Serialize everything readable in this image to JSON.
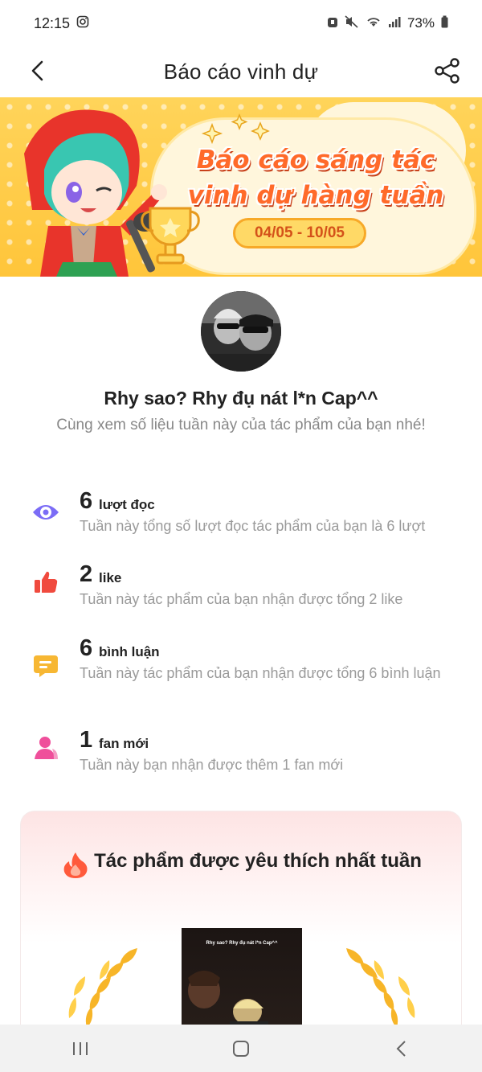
{
  "status_bar": {
    "time": "12:15",
    "battery": "73%"
  },
  "header": {
    "title": "Báo cáo vinh dự"
  },
  "banner": {
    "headline_line1": "Báo cáo sáng tác",
    "headline_line2": "vinh dự hàng tuần",
    "date_range": "04/05 - 10/05"
  },
  "profile": {
    "name": "Rhy sao? Rhy đụ nát l*n Cap^^",
    "subtitle": "Cùng xem số liệu tuần này của tác phẩm của bạn nhé!"
  },
  "stats": [
    {
      "icon": "eye-icon",
      "number": "6",
      "unit": "lượt đọc",
      "desc": "Tuần này tổng số lượt đọc tác phẩm của bạn là 6 lượt",
      "color": "#7b6cf6"
    },
    {
      "icon": "thumbs-up-icon",
      "number": "2",
      "unit": "like",
      "desc": "Tuần này tác phẩm của bạn nhận được tổng 2 like",
      "color": "#f04a3e"
    },
    {
      "icon": "comment-icon",
      "number": "6",
      "unit": "bình luận",
      "desc": "Tuần này tác phẩm của bạn nhận được tổng 6 bình luận",
      "color": "#f7b733"
    },
    {
      "icon": "person-icon",
      "number": "1",
      "unit": "fan mới",
      "desc": "Tuần này bạn nhận được thêm 1 fan mới",
      "color": "#ef4f9b"
    }
  ],
  "favorite": {
    "title": "Tác phẩm được yêu thích nhất tuần",
    "cover_text": "Rhy sao? Rhy đụ nát l*n Cap^^"
  },
  "colors": {
    "accent_orange": "#ff6a2a",
    "banner_yellow": "#ffc53a",
    "muted_text": "#9a9a9a"
  }
}
